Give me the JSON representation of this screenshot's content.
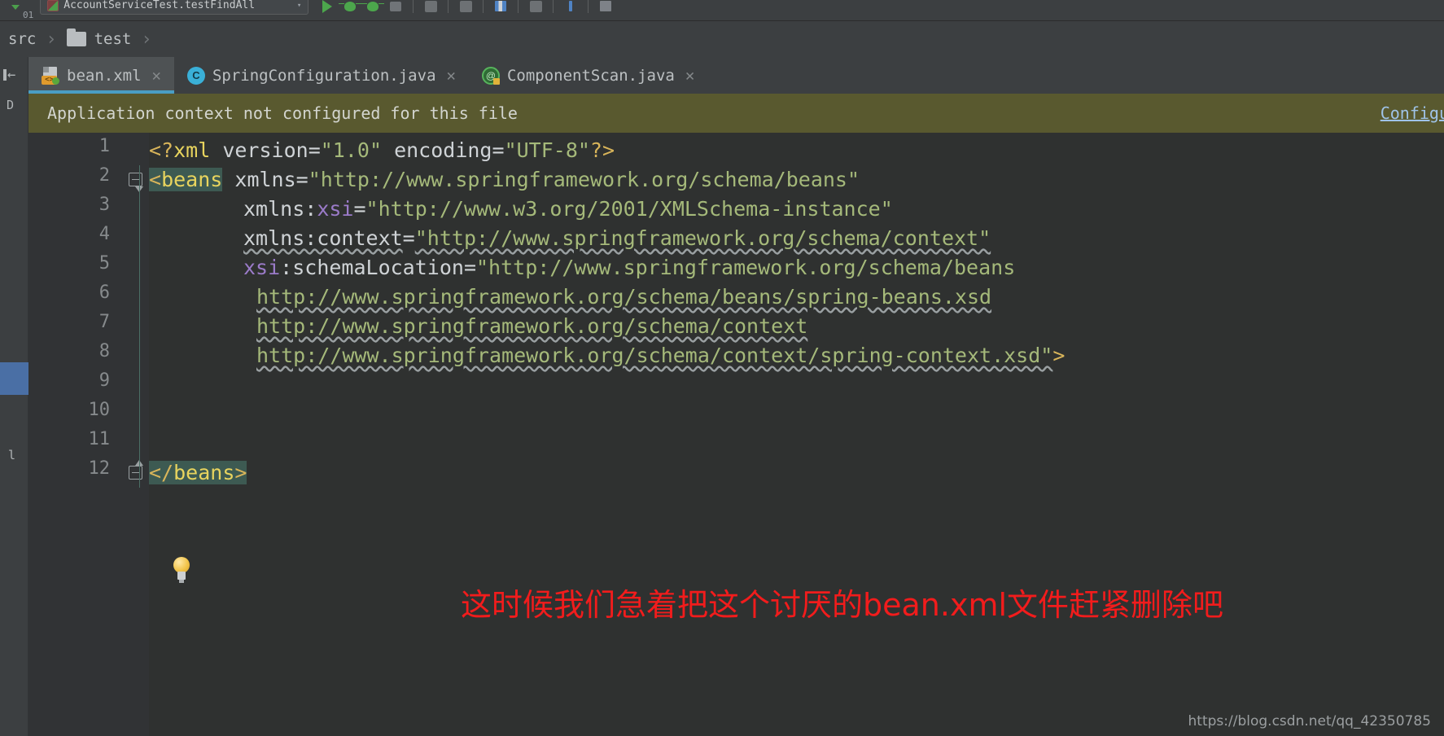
{
  "toolbar": {
    "version_label": "01",
    "run_config": "AccountServiceTest.testFindAll",
    "run_config_arrow": "▾",
    "buttons": [
      {
        "name": "run-button",
        "label": "Run"
      },
      {
        "name": "debug-button",
        "label": "Debug"
      },
      {
        "name": "run-with-coverage-button",
        "label": "Run with Coverage"
      },
      {
        "name": "stop-button",
        "label": "Stop"
      },
      {
        "name": "update-button",
        "label": "Update"
      },
      {
        "name": "vcs-commit-button",
        "label": "Commit"
      },
      {
        "name": "layout-button",
        "label": "Layout"
      },
      {
        "name": "rollback-button",
        "label": "Rollback"
      },
      {
        "name": "info-button",
        "label": "Info"
      },
      {
        "name": "save-all-button",
        "label": "Save All"
      }
    ]
  },
  "breadcrumb": {
    "items": [
      {
        "label": "src",
        "icon": ""
      },
      {
        "label": "test",
        "icon": "folder-icon"
      }
    ],
    "separator": "›"
  },
  "left_rail": {
    "collapse_label": "←",
    "project_label": "D",
    "bottom_label": "l"
  },
  "tabs": [
    {
      "label": "bean.xml",
      "icon": "xml-file-icon",
      "active": true,
      "close": "✕",
      "badge": "<>"
    },
    {
      "label": "SpringConfiguration.java",
      "icon": "java-class-icon",
      "active": false,
      "close": "✕",
      "badge": "C"
    },
    {
      "label": "ComponentScan.java",
      "icon": "java-annotation-icon",
      "active": false,
      "close": "✕",
      "badge": "@"
    }
  ],
  "notification": {
    "message": "Application context not configured for this file",
    "link": "Configu",
    "background": "#59592f"
  },
  "editor": {
    "line_numbers": [
      "1",
      "2",
      "3",
      "4",
      "5",
      "6",
      "7",
      "8",
      "9",
      "10",
      "11",
      "12"
    ],
    "lines": [
      {
        "n": 1,
        "indent": 0,
        "tokens": [
          {
            "t": "<?",
            "c": "t-punct"
          },
          {
            "t": "xml",
            "c": "t-tag"
          },
          {
            "t": " ",
            "c": "t-attr"
          },
          {
            "t": "version",
            "c": "t-attr"
          },
          {
            "t": "=",
            "c": "t-eq"
          },
          {
            "t": "\"1.0\"",
            "c": "t-val"
          },
          {
            "t": " ",
            "c": "t-attr"
          },
          {
            "t": "encoding",
            "c": "t-attr"
          },
          {
            "t": "=",
            "c": "t-eq"
          },
          {
            "t": "\"UTF-8\"",
            "c": "t-val"
          },
          {
            "t": "?>",
            "c": "t-punct"
          }
        ]
      },
      {
        "n": 2,
        "indent": 0,
        "tokens": [
          {
            "t": "<",
            "c": "t-punct hl-tag"
          },
          {
            "t": "beans",
            "c": "t-tag hl-tag"
          },
          {
            "t": " ",
            "c": "t-attr"
          },
          {
            "t": "xmlns",
            "c": "t-attr"
          },
          {
            "t": "=",
            "c": "t-eq"
          },
          {
            "t": "\"http://www.springframework.org/schema/beans\"",
            "c": "t-val"
          }
        ]
      },
      {
        "n": 3,
        "indent": 1,
        "tokens": [
          {
            "t": "xmlns",
            "c": "t-attr"
          },
          {
            "t": ":",
            "c": "t-attr"
          },
          {
            "t": "xsi",
            "c": "t-ns"
          },
          {
            "t": "=",
            "c": "t-eq"
          },
          {
            "t": "\"http://www.w3.org/2001/XMLSchema-instance\"",
            "c": "t-val"
          }
        ]
      },
      {
        "n": 4,
        "indent": 1,
        "tokens": [
          {
            "t": "xmlns:context",
            "c": "t-attr wavy"
          },
          {
            "t": "=",
            "c": "t-eq"
          },
          {
            "t": "\"http://www.springframework.org/schema/context\"",
            "c": "t-val wavy"
          }
        ]
      },
      {
        "n": 5,
        "indent": 1,
        "tokens": [
          {
            "t": "xsi",
            "c": "t-ns"
          },
          {
            "t": ":",
            "c": "t-attr"
          },
          {
            "t": "schemaLocation",
            "c": "t-attr"
          },
          {
            "t": "=",
            "c": "t-eq"
          },
          {
            "t": "\"http://www.springframework.org/schema/beans",
            "c": "t-val"
          }
        ]
      },
      {
        "n": 6,
        "indent": 2,
        "tokens": [
          {
            "t": "http://www.springframework.org/schema/beans/spring-beans.xsd",
            "c": "t-val wavy"
          }
        ]
      },
      {
        "n": 7,
        "indent": 2,
        "tokens": [
          {
            "t": "http://www.springframework.org/schema/context",
            "c": "t-val wavy"
          }
        ]
      },
      {
        "n": 8,
        "indent": 2,
        "tokens": [
          {
            "t": "http://www.springframework.org/schema/context/spring-context.xsd\"",
            "c": "t-val wavy"
          },
          {
            "t": ">",
            "c": "t-punct"
          }
        ]
      },
      {
        "n": 9,
        "indent": 0,
        "tokens": []
      },
      {
        "n": 10,
        "indent": 0,
        "tokens": []
      },
      {
        "n": 11,
        "indent": 0,
        "tokens": []
      },
      {
        "n": 12,
        "indent": 0,
        "tokens": [
          {
            "t": "</",
            "c": "t-punct hl-tag"
          },
          {
            "t": "beans",
            "c": "t-tag hl-tag"
          },
          {
            "t": ">",
            "c": "t-punct hl-tag"
          }
        ]
      }
    ],
    "fold_markers": [
      {
        "line": 2,
        "type": "top"
      },
      {
        "line": 12,
        "type": "bot"
      }
    ],
    "intention_bulb": {
      "name": "intention-bulb-icon",
      "line": 11
    }
  },
  "annotation": {
    "text": "这时候我们急着把这个讨厌的bean.xml文件赶紧删除吧",
    "color": "#f21c1c"
  },
  "watermark": "https://blog.csdn.net/qq_42350785"
}
